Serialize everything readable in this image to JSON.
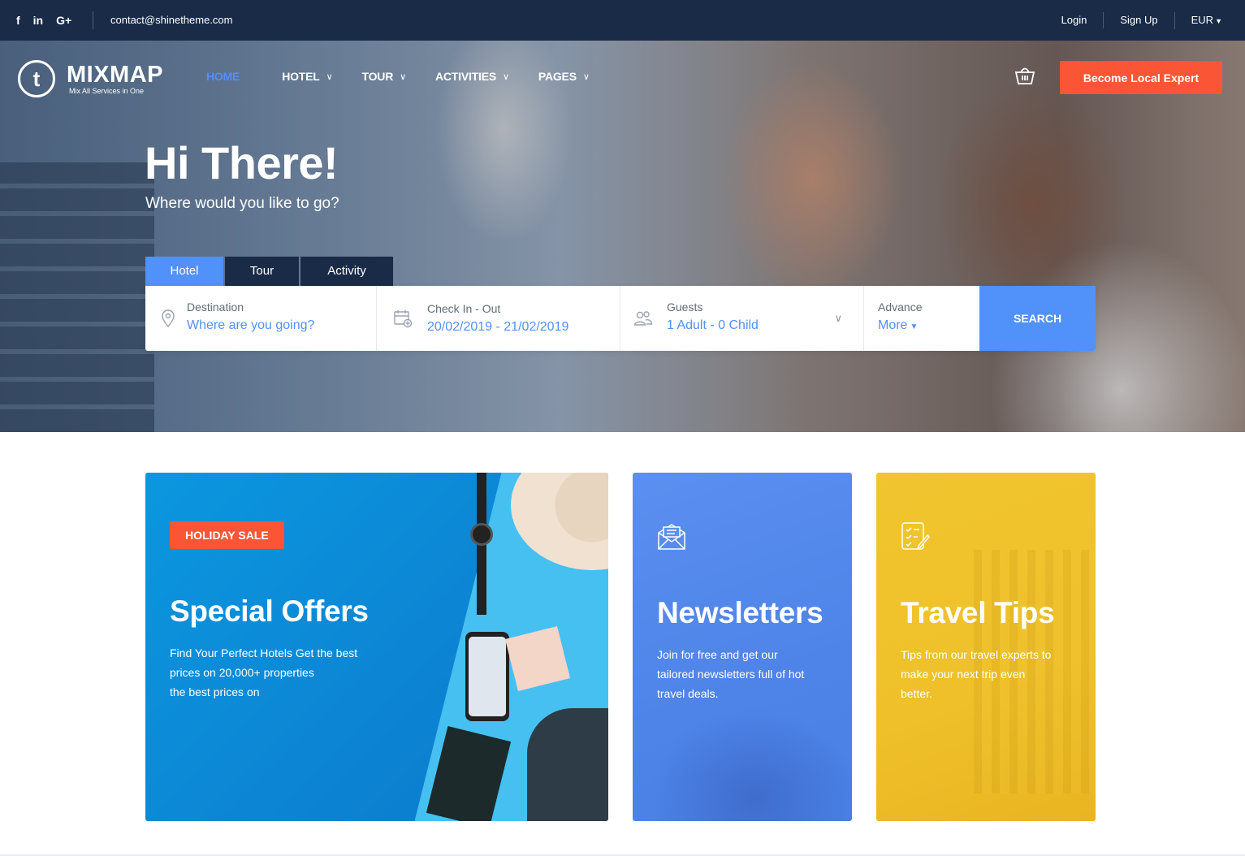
{
  "topbar": {
    "social": [
      "f",
      "in",
      "G+"
    ],
    "email": "contact@shinetheme.com",
    "login": "Login",
    "signup": "Sign Up",
    "currency": "EUR"
  },
  "header": {
    "logo_letter": "t",
    "brand": "MIXMAP",
    "tagline": "Mix All Services in One",
    "nav": [
      {
        "label": "HOME"
      },
      {
        "label": "HOTEL"
      },
      {
        "label": "TOUR"
      },
      {
        "label": "ACTIVITIES"
      },
      {
        "label": "PAGES"
      }
    ],
    "cta": "Become Local Expert"
  },
  "hero": {
    "title": "Hi There!",
    "subtitle": "Where would you like to go?",
    "tabs": [
      "Hotel",
      "Tour",
      "Activity"
    ],
    "search": {
      "destination_label": "Destination",
      "destination_placeholder": "Where are you going?",
      "checkin_label": "Check In - Out",
      "checkin_value": "20/02/2019 - 21/02/2019",
      "guests_label": "Guests",
      "guests_value": "1 Adult - 0 Child",
      "advance_label": "Advance",
      "advance_value": "More",
      "button": "SEARCH"
    }
  },
  "cards": {
    "offers": {
      "badge": "HOLIDAY SALE",
      "title": "Special Offers",
      "lines": [
        "Find Your Perfect Hotels Get the best",
        "prices on 20,000+ properties",
        "the best prices on"
      ]
    },
    "newsletters": {
      "title": "Newsletters",
      "lines": [
        "Join for free and get our",
        "tailored newsletters full of hot",
        "travel deals."
      ]
    },
    "tips": {
      "title": "Travel Tips",
      "lines": [
        "Tips from our travel experts to",
        "make your next trip even",
        "better."
      ]
    }
  },
  "colors": {
    "navy": "#1a2b48",
    "accent_blue": "#5191fa",
    "orange": "#fa5636",
    "yellow": "#f0c52e"
  },
  "icons": {
    "facebook": "facebook-icon",
    "linkedin": "linkedin-icon",
    "googleplus": "google-plus-icon",
    "cart": "basket-icon",
    "destination": "map-pin-icon",
    "checkin": "calendar-plus-icon",
    "guests": "users-icon",
    "newsletter": "envelope-icon",
    "tips": "checklist-icon"
  }
}
